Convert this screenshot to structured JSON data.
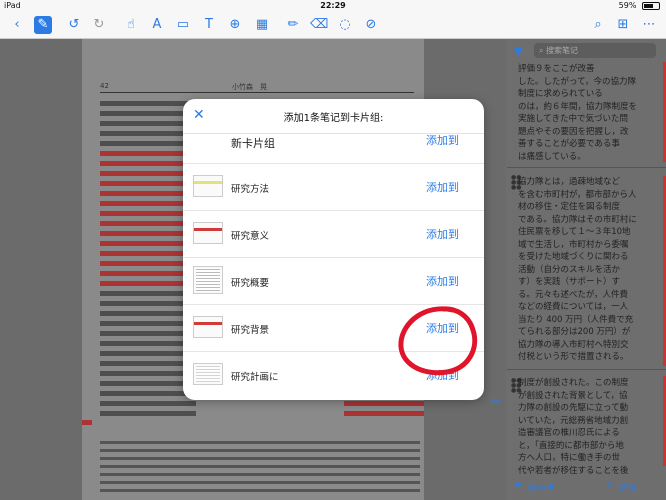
{
  "status_bar": {
    "device": "iPad",
    "time": "22:29",
    "battery": "59%"
  },
  "page": {
    "page_number": "42",
    "author": "小竹森　晃"
  },
  "sidebar": {
    "search_placeholder": "搜索笔记",
    "notes": [
      "評価９をここが改善\nした。したがって，今の協力隊\n制度に求められている\nのは，約６年間，協力隊制度を\n実施してきた中で気づいた問\n題点やその要因を把握し，改\n善することが必要である事\nは痛感している。",
      "協力隊とは，過疎地域など\nを含む市町村が，都市部から人\n材の移住・定住を図る制度\nである。協力隊はその市町村に\n住民票を移して１～３年10地\n域で生活し，市町村から委嘱\nを受けた地域づくりに関わる\n活動（自分のスキルを活か\nす）を実践（サポート）す\nる。元々も述べたが，人件費\nなどの経費については，一人\n当たり 400 万円（人件費で充\nてられる部分は200 万円）が\n協力隊の導入市町村へ特別交\n付税という形で措置される。",
      "制度が創設された。この制度\nが創設された背景として，協\n力隊の創設の先駆に立って動\nいていた，元総務省地域力創\n造審議官の椎川忍氏による\nと，「直接的に都市部から地\n方へ人口，特に働き手の世\n代や若者が移住することを後"
    ],
    "bottom_left": "划重点",
    "bottom_right": "选择"
  },
  "dialog": {
    "title": "添加1条笔记到卡片组:",
    "rows": [
      {
        "label": "新卡片组",
        "action": "添加到"
      },
      {
        "label": "研究方法",
        "action": "添加到"
      },
      {
        "label": "研究意义",
        "action": "添加到"
      },
      {
        "label": "研究概要",
        "action": "添加到"
      },
      {
        "label": "研究背景",
        "action": "添加到"
      },
      {
        "label": "研究計画に",
        "action": "添加到"
      }
    ]
  },
  "colors": {
    "accent": "#2c7be5",
    "annotation": "#e0142a",
    "highlight": "#a33"
  }
}
